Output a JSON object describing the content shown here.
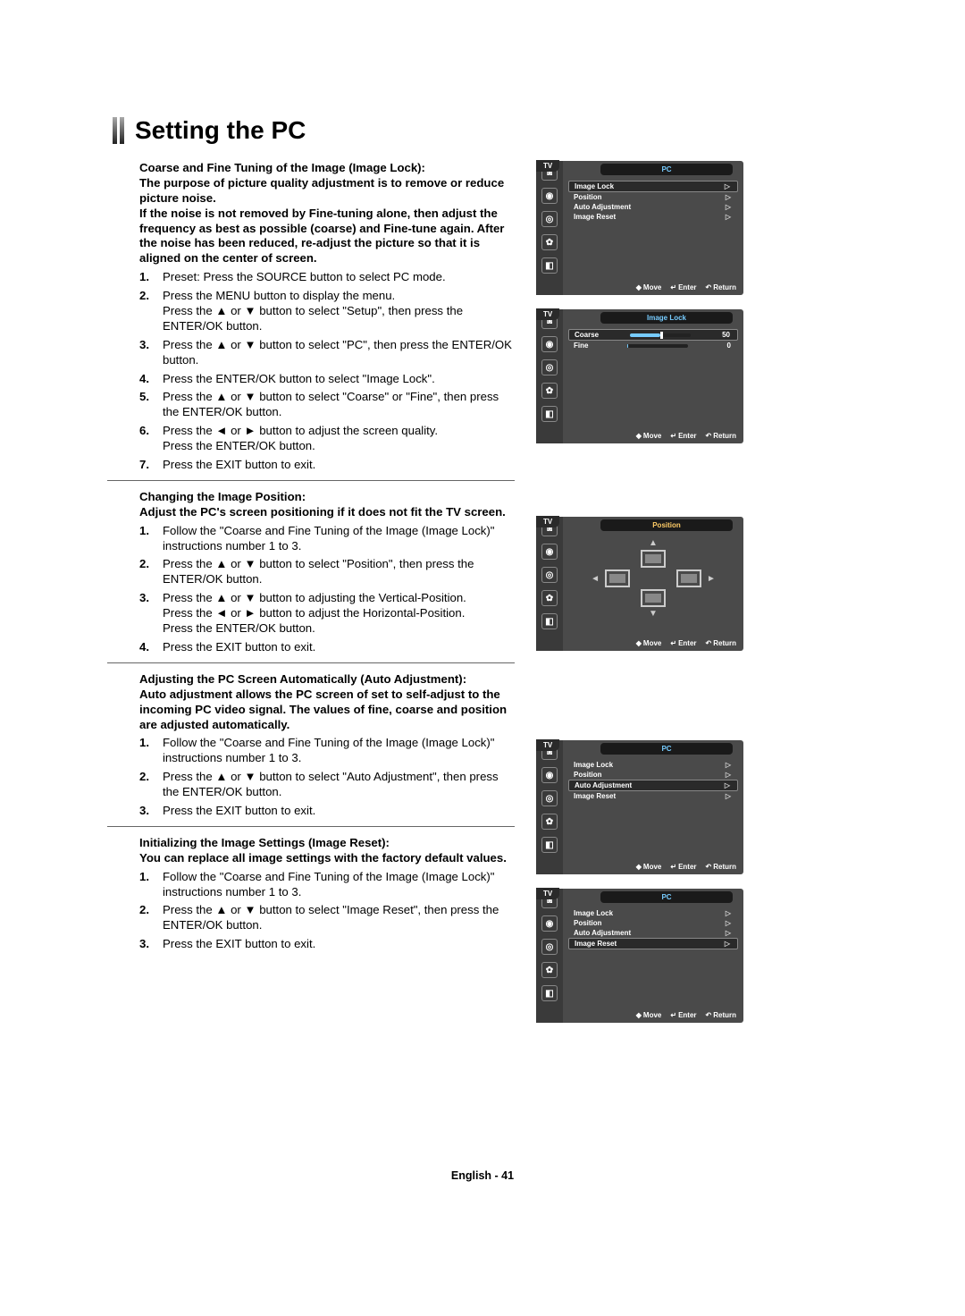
{
  "title": "Setting the PC",
  "footer": "English - 41",
  "symbols": {
    "up": "▲",
    "down": "▼",
    "left": "◄",
    "right": "►",
    "tri_right": "▷",
    "updown": "◆",
    "enter_glyph": "↵",
    "return_glyph": "↶"
  },
  "sections": {
    "imageLock": {
      "intro": "Coarse and Fine Tuning of the Image (Image Lock):\nThe purpose of picture quality adjustment is to remove or reduce picture noise.\nIf the noise is not removed by Fine-tuning alone, then adjust the frequency as best as possible (coarse) and Fine-tune again. After the noise has been reduced, re-adjust the picture so that it is aligned on the center of screen.",
      "steps": [
        "Preset: Press the SOURCE button to select PC mode.",
        "Press the MENU button to display the menu.\nPress the ▲ or ▼ button to select \"Setup\", then press the ENTER/OK button.",
        "Press the ▲ or ▼ button to select \"PC\", then press the ENTER/OK button.",
        "Press the ENTER/OK button to select \"Image Lock\".",
        "Press the ▲ or ▼ button to select \"Coarse\" or \"Fine\", then press the ENTER/OK button.",
        "Press the ◄ or ► button to adjust the screen quality.\nPress the ENTER/OK button.",
        "Press the EXIT button to exit."
      ]
    },
    "position": {
      "intro": "Changing the Image Position:\nAdjust the PC's screen positioning if it does not fit the TV screen.",
      "steps": [
        "Follow the \"Coarse and Fine Tuning of the Image (Image Lock)\" instructions number 1 to 3.",
        "Press the ▲ or ▼ button to select \"Position\", then press the ENTER/OK button.",
        "Press the ▲ or ▼ button to adjusting the Vertical-Position.\nPress the ◄ or ► button to adjust the Horizontal-Position.\nPress the ENTER/OK button.",
        "Press the EXIT button to exit."
      ]
    },
    "autoAdj": {
      "intro": "Adjusting the PC Screen Automatically (Auto Adjustment):\nAuto adjustment allows the PC screen of set to self-adjust to the incoming PC video signal. The values of fine, coarse and position are adjusted automatically.",
      "steps": [
        "Follow the \"Coarse and Fine Tuning of the Image (Image Lock)\" instructions number 1 to 3.",
        "Press the ▲ or ▼ button to select \"Auto Adjustment\", then press the ENTER/OK button.",
        "Press the EXIT button to exit."
      ]
    },
    "imageReset": {
      "intro": "Initializing the Image Settings (Image Reset):\nYou can replace all image settings with the factory default values.",
      "steps": [
        "Follow the \"Coarse and Fine Tuning of the Image (Image Lock)\" instructions number 1 to 3.",
        "Press the ▲ or ▼ button to select \"Image Reset\", then press the ENTER/OK button.",
        "Press the EXIT button to exit."
      ]
    }
  },
  "osd": {
    "tv_label": "TV",
    "footer": {
      "move": "Move",
      "enter": "Enter",
      "return": "Return"
    },
    "pc_menu": {
      "title": "PC",
      "items": [
        "Image Lock",
        "Position",
        "Auto Adjustment",
        "Image Reset"
      ]
    },
    "image_lock_menu": {
      "title": "Image Lock",
      "coarse": {
        "label": "Coarse",
        "value": "50"
      },
      "fine": {
        "label": "Fine",
        "value": "0"
      }
    },
    "position_menu": {
      "title": "Position"
    }
  }
}
